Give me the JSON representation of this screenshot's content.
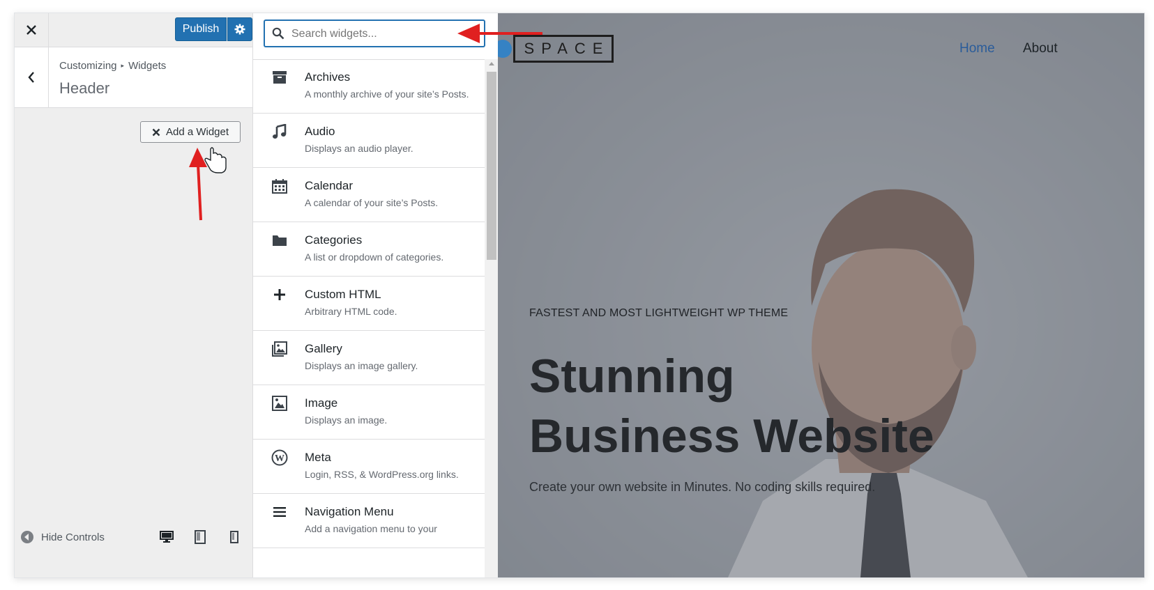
{
  "header": {
    "close_label": "✕",
    "publish_label": "Publish",
    "settings_icon": "gear-icon"
  },
  "section": {
    "breadcrumb_root": "Customizing",
    "breadcrumb_child": "Widgets",
    "title": "Header",
    "add_widget_label": "Add a Widget"
  },
  "footer": {
    "hide_controls_label": "Hide Controls",
    "devices": [
      "desktop-icon",
      "tablet-icon",
      "mobile-icon"
    ]
  },
  "widgets": {
    "search_placeholder": "Search widgets...",
    "items": [
      {
        "name": "Archives",
        "desc": "A monthly archive of your site’s Posts.",
        "icon": "archive-icon"
      },
      {
        "name": "Audio",
        "desc": "Displays an audio player.",
        "icon": "music-note-icon"
      },
      {
        "name": "Calendar",
        "desc": "A calendar of your site’s Posts.",
        "icon": "calendar-icon"
      },
      {
        "name": "Categories",
        "desc": "A list or dropdown of categories.",
        "icon": "folder-icon"
      },
      {
        "name": "Custom HTML",
        "desc": "Arbitrary HTML code.",
        "icon": "plus-icon"
      },
      {
        "name": "Gallery",
        "desc": "Displays an image gallery.",
        "icon": "gallery-icon"
      },
      {
        "name": "Image",
        "desc": "Displays an image.",
        "icon": "image-icon"
      },
      {
        "name": "Meta",
        "desc": "Login, RSS, & WordPress.org links.",
        "icon": "wordpress-icon"
      },
      {
        "name": "Navigation Menu",
        "desc": "Add a navigation menu to your",
        "icon": "menu-icon"
      }
    ]
  },
  "preview": {
    "logo_text": "SPACE",
    "nav_home": "Home",
    "nav_about": "About",
    "eyebrow": "FASTEST AND MOST LIGHTWEIGHT WP THEME",
    "headline_line1": "Stunning",
    "headline_line2": "Business Website",
    "subtext": "Create your own website in Minutes. No coding skills required.",
    "colors": {
      "nav_active": "#2a5c9a",
      "nav": "#1d2327",
      "accent": "#2271b1",
      "arrow": "#e02020"
    }
  }
}
